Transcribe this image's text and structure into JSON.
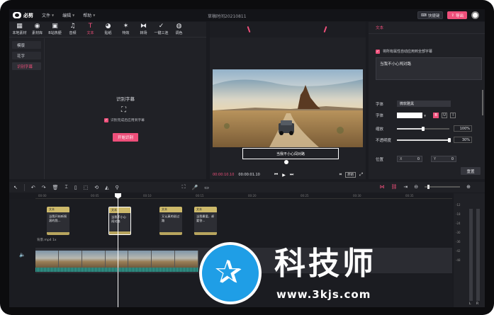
{
  "app": {
    "logo_text": "必剪",
    "project_title": "草稿时间20210811"
  },
  "menu": [
    {
      "label": "文件"
    },
    {
      "label": "编辑"
    },
    {
      "label": "帮助"
    }
  ],
  "topbar": {
    "shortcut_label": "快捷键",
    "export_label": "导出"
  },
  "tools": [
    {
      "label": "本地素材",
      "icon": "folder-icon",
      "glyph": "▦"
    },
    {
      "label": "素材库",
      "icon": "library-icon",
      "glyph": "◉"
    },
    {
      "label": "B站热梗",
      "icon": "bilibili-icon",
      "glyph": "▣"
    },
    {
      "label": "音频",
      "icon": "music-icon",
      "glyph": "♫"
    },
    {
      "label": "文本",
      "icon": "text-icon",
      "glyph": "T"
    },
    {
      "label": "贴纸",
      "icon": "sticker-icon",
      "glyph": "◕"
    },
    {
      "label": "特效",
      "icon": "effect-icon",
      "glyph": "✶"
    },
    {
      "label": "转场",
      "icon": "transition-icon",
      "glyph": "⧓"
    },
    {
      "label": "一键三连",
      "icon": "like-icon",
      "glyph": "✓"
    },
    {
      "label": "调色",
      "icon": "palette-icon",
      "glyph": "◍"
    }
  ],
  "side_tabs": [
    {
      "label": "模版"
    },
    {
      "label": "花字"
    },
    {
      "label": "识别字幕"
    }
  ],
  "caption_panel": {
    "title": "识别字幕",
    "checkbox_label": "识别完成后应用到字幕",
    "start_button": "开始识别"
  },
  "player": {
    "subtitle": "当我不小心闯对路",
    "current_time": "00:00:10.10",
    "total_time": "00:00:01.10",
    "original_label": "原始"
  },
  "properties": {
    "header": "文本",
    "apply_all_label": "将所有属性自动应用到全部字幕",
    "text_value": "当我不小心闯对路",
    "font_label": "字体",
    "font_value": "微软雅黑",
    "style_label": "字体",
    "scale_label": "缩放",
    "scale_value": "100%",
    "scale_level": 0.5,
    "opacity_label": "不透明度",
    "opacity_value": "30%",
    "opacity_level": 1,
    "position_label": "位置",
    "pos_x_label": "X",
    "pos_x_value": "0",
    "pos_y_label": "Y",
    "pos_y_value": "0",
    "reset_label": "重置",
    "format_buttons": [
      {
        "label": "B"
      },
      {
        "label": "U"
      },
      {
        "label": "I"
      }
    ]
  },
  "ruler": [
    "00:00",
    "00:05",
    "00:10",
    "00:15",
    "00:20",
    "00:25",
    "00:30",
    "00:35"
  ],
  "clips": [
    {
      "tag": "文本",
      "text": "当我开始听摇滚的我..."
    },
    {
      "tag": "文本",
      "text": "当我不小心闯对路"
    },
    {
      "tag": "文本",
      "text": "又认真的说过路"
    },
    {
      "tag": "文本",
      "text": "当我最爱，却要答..."
    }
  ],
  "video_track": {
    "label": "背景.mp4  1x"
  },
  "vu_meter": {
    "scale": [
      "-12",
      "-18",
      "-24",
      "-30",
      "-36",
      "-42",
      "-48"
    ],
    "left": "L",
    "right": "R"
  },
  "watermark": {
    "title": "科技师",
    "url": "www.3kjs.com"
  },
  "colors": {
    "accent": "#ee4f7a",
    "panel": "#202126",
    "background": "#1a1b20",
    "clip": "#cdb96a"
  }
}
